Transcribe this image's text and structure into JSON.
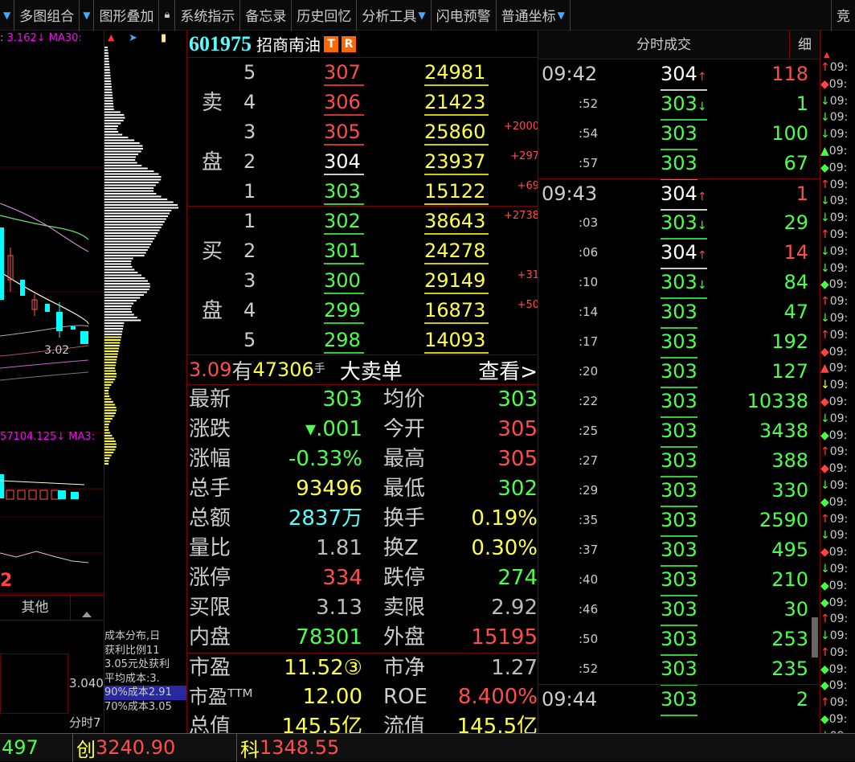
{
  "toolbar": {
    "items": [
      "多图组合",
      "图形叠加",
      "系统指示",
      "备忘录",
      "历史回忆",
      "分析工具",
      "闪电预警",
      "普通坐标"
    ],
    "right_label": "竞"
  },
  "left_panel": {
    "ma_line": "3.162↓ MA30:",
    "price_label": "3.02",
    "vol_line": "57104.125↓ MA3:",
    "red_number": "2",
    "other_tab": "其他",
    "mini_value": "3.040",
    "mini_label": "分时7"
  },
  "chip": {
    "text_lines": [
      "成本分布,日",
      "获利比例11",
      "3.05元处获利",
      "平均成本:3.",
      "90%成本2.91",
      "70%成本3.05"
    ]
  },
  "quote": {
    "code": "601975",
    "name": "招商南油",
    "badge_t": "T",
    "badge_r": "R",
    "sell_label_1": "卖",
    "sell_label_2": "盘",
    "buy_label_1": "买",
    "buy_label_2": "盘",
    "sell": [
      {
        "level": "5",
        "price": "307",
        "volume": "24981",
        "change": ""
      },
      {
        "level": "4",
        "price": "306",
        "volume": "21423",
        "change": ""
      },
      {
        "level": "3",
        "price": "305",
        "volume": "25860",
        "change": "+2000"
      },
      {
        "level": "2",
        "price": "304",
        "volume": "23937",
        "change": "+297"
      },
      {
        "level": "1",
        "price": "303",
        "volume": "15122",
        "change": "+69"
      }
    ],
    "buy": [
      {
        "level": "1",
        "price": "302",
        "volume": "38643",
        "change": "+2738"
      },
      {
        "level": "2",
        "price": "301",
        "volume": "24278",
        "change": ""
      },
      {
        "level": "3",
        "price": "300",
        "volume": "29149",
        "change": "+31"
      },
      {
        "level": "4",
        "price": "299",
        "volume": "16873",
        "change": "+50"
      },
      {
        "level": "5",
        "price": "298",
        "volume": "14093",
        "change": ""
      }
    ],
    "big_order": {
      "price": "3.09",
      "text": "有",
      "amount": "47306",
      "unit": "手",
      "label": "大卖单",
      "link": "查看>"
    },
    "stats": [
      {
        "l1": "最新",
        "v1": "303",
        "c1": "grn",
        "l2": "均价",
        "v2": "303",
        "c2": "grn"
      },
      {
        "l1": "涨跌",
        "v1": "▾.001",
        "c1": "grn",
        "l2": "今开",
        "v2": "305",
        "c2": "red"
      },
      {
        "l1": "涨幅",
        "v1": "-0.33%",
        "c1": "grn",
        "l2": "最高",
        "v2": "305",
        "c2": "red"
      },
      {
        "l1": "总手",
        "v1": "93496",
        "c1": "yel",
        "l2": "最低",
        "v2": "302",
        "c2": "grn"
      },
      {
        "l1": "总额",
        "v1": "2837万",
        "c1": "cyan",
        "l2": "换手",
        "v2": "0.19%",
        "c2": "yel"
      },
      {
        "l1": "量比",
        "v1": "1.81",
        "c1": "gry",
        "l2": "换Z",
        "v2": "0.30%",
        "c2": "yel"
      },
      {
        "l1": "涨停",
        "v1": "334",
        "c1": "red",
        "l2": "跌停",
        "v2": "274",
        "c2": "grn"
      },
      {
        "l1": "买限",
        "v1": "3.13",
        "c1": "gry",
        "l2": "卖限",
        "v2": "2.92",
        "c2": "gry"
      },
      {
        "l1": "内盘",
        "v1": "78301",
        "c1": "grn",
        "l2": "外盘",
        "v2": "15195",
        "c2": "red"
      },
      {
        "l1": "市盈",
        "v1": "11.52③",
        "c1": "yel",
        "l2": "市净",
        "v2": "1.27",
        "c2": "gry"
      },
      {
        "l1": "市盈ᵀᵀᴹ",
        "v1": "12.00",
        "c1": "yel",
        "l2": "ROE",
        "v2": "8.400%",
        "c2": "red"
      },
      {
        "l1": "总值",
        "v1": "145.5亿",
        "c1": "yel",
        "l2": "流值",
        "v2": "145.5亿",
        "c2": "yel"
      }
    ]
  },
  "trades": {
    "title": "分时成交",
    "detail_tab": "细",
    "rows": [
      {
        "time": "09:42",
        "big": true,
        "price": "304",
        "pc": "wht",
        "arrow": "↑",
        "vol": "118",
        "vc": "red"
      },
      {
        "time": ":52",
        "big": false,
        "price": "303",
        "pc": "grn",
        "arrow": "↓",
        "vol": "1",
        "vc": "grn"
      },
      {
        "time": ":54",
        "big": false,
        "price": "303",
        "pc": "grn",
        "arrow": "",
        "vol": "100",
        "vc": "grn"
      },
      {
        "time": ":57",
        "big": false,
        "price": "303",
        "pc": "grn",
        "arrow": "",
        "vol": "67",
        "vc": "grn"
      },
      {
        "time": "09:43",
        "big": true,
        "price": "304",
        "pc": "wht",
        "arrow": "↑",
        "vol": "1",
        "vc": "red"
      },
      {
        "time": ":03",
        "big": false,
        "price": "303",
        "pc": "grn",
        "arrow": "↓",
        "vol": "29",
        "vc": "grn"
      },
      {
        "time": ":06",
        "big": false,
        "price": "304",
        "pc": "wht",
        "arrow": "↑",
        "vol": "14",
        "vc": "red"
      },
      {
        "time": ":10",
        "big": false,
        "price": "303",
        "pc": "grn",
        "arrow": "↓",
        "vol": "84",
        "vc": "grn"
      },
      {
        "time": ":14",
        "big": false,
        "price": "303",
        "pc": "grn",
        "arrow": "",
        "vol": "47",
        "vc": "grn"
      },
      {
        "time": ":17",
        "big": false,
        "price": "303",
        "pc": "grn",
        "arrow": "",
        "vol": "192",
        "vc": "grn"
      },
      {
        "time": ":20",
        "big": false,
        "price": "303",
        "pc": "grn",
        "arrow": "",
        "vol": "127",
        "vc": "grn"
      },
      {
        "time": ":22",
        "big": false,
        "price": "303",
        "pc": "grn",
        "arrow": "",
        "vol": "10338",
        "vc": "grn"
      },
      {
        "time": ":25",
        "big": false,
        "price": "303",
        "pc": "grn",
        "arrow": "",
        "vol": "3438",
        "vc": "grn"
      },
      {
        "time": ":27",
        "big": false,
        "price": "303",
        "pc": "grn",
        "arrow": "",
        "vol": "388",
        "vc": "grn"
      },
      {
        "time": ":29",
        "big": false,
        "price": "303",
        "pc": "grn",
        "arrow": "",
        "vol": "330",
        "vc": "grn"
      },
      {
        "time": ":35",
        "big": false,
        "price": "303",
        "pc": "grn",
        "arrow": "",
        "vol": "2590",
        "vc": "grn"
      },
      {
        "time": ":37",
        "big": false,
        "price": "303",
        "pc": "grn",
        "arrow": "",
        "vol": "495",
        "vc": "grn"
      },
      {
        "time": ":40",
        "big": false,
        "price": "303",
        "pc": "grn",
        "arrow": "",
        "vol": "210",
        "vc": "grn"
      },
      {
        "time": ":46",
        "big": false,
        "price": "303",
        "pc": "grn",
        "arrow": "",
        "vol": "30",
        "vc": "grn"
      },
      {
        "time": ":50",
        "big": false,
        "price": "303",
        "pc": "grn",
        "arrow": "",
        "vol": "253",
        "vc": "grn"
      },
      {
        "time": ":52",
        "big": false,
        "price": "303",
        "pc": "grn",
        "arrow": "",
        "vol": "235",
        "vc": "grn"
      },
      {
        "time": "09:44",
        "big": true,
        "price": "303",
        "pc": "grn",
        "arrow": "",
        "vol": "2",
        "vc": "grn"
      }
    ]
  },
  "right_strip": {
    "rows": [
      {
        "sym": "↑",
        "c": "red",
        "t": "09:"
      },
      {
        "sym": "◆",
        "c": "red",
        "t": "09:"
      },
      {
        "sym": "↓",
        "c": "grn",
        "t": "09:"
      },
      {
        "sym": "↓",
        "c": "grn",
        "t": "09:"
      },
      {
        "sym": "↓",
        "c": "grn",
        "t": "09:"
      },
      {
        "sym": "▲",
        "c": "grn",
        "t": "09:"
      },
      {
        "sym": "◆",
        "c": "grn",
        "t": "09:"
      },
      {
        "sym": "↑",
        "c": "red",
        "t": "09:"
      },
      {
        "sym": "↓",
        "c": "grn",
        "t": "09:"
      },
      {
        "sym": "↓",
        "c": "grn",
        "t": "09:"
      },
      {
        "sym": "↑",
        "c": "red",
        "t": "09:"
      },
      {
        "sym": "↓",
        "c": "grn",
        "t": "09:"
      },
      {
        "sym": "↓",
        "c": "grn",
        "t": "09:"
      },
      {
        "sym": "◆",
        "c": "grn",
        "t": "09:"
      },
      {
        "sym": "↑",
        "c": "red",
        "t": "09:"
      },
      {
        "sym": "↓",
        "c": "grn",
        "t": "09:"
      },
      {
        "sym": "↑",
        "c": "red",
        "t": "09:"
      },
      {
        "sym": "◆",
        "c": "red",
        "t": "09:"
      },
      {
        "sym": "▲",
        "c": "red",
        "t": "09:"
      },
      {
        "sym": "↓",
        "c": "yel",
        "t": "09:"
      },
      {
        "sym": "◆",
        "c": "red",
        "t": "09:"
      },
      {
        "sym": "↓",
        "c": "grn",
        "t": "09:"
      },
      {
        "sym": "◆",
        "c": "grn",
        "t": "09:"
      },
      {
        "sym": "↑",
        "c": "red",
        "t": "09:"
      },
      {
        "sym": "◆",
        "c": "red",
        "t": "09:"
      },
      {
        "sym": "↓",
        "c": "grn",
        "t": "09:"
      },
      {
        "sym": "◆",
        "c": "grn",
        "t": "09:"
      },
      {
        "sym": "↑",
        "c": "red",
        "t": "09:"
      },
      {
        "sym": "↓",
        "c": "grn",
        "t": "09:"
      },
      {
        "sym": "◆",
        "c": "red",
        "t": "09:"
      },
      {
        "sym": "↓",
        "c": "grn",
        "t": "09:"
      },
      {
        "sym": "◆",
        "c": "grn",
        "t": "09:"
      },
      {
        "sym": "◆",
        "c": "grn",
        "t": "09:"
      },
      {
        "sym": "↑",
        "c": "red",
        "t": "09:"
      },
      {
        "sym": "↓",
        "c": "grn",
        "t": "09:"
      },
      {
        "sym": "↑",
        "c": "red",
        "t": "09:"
      },
      {
        "sym": "◆",
        "c": "grn",
        "t": "09:"
      },
      {
        "sym": "◆",
        "c": "grn",
        "t": "09:"
      },
      {
        "sym": "↑",
        "c": "red",
        "t": "09:"
      },
      {
        "sym": "◆",
        "c": "grn",
        "t": "09:"
      },
      {
        "sym": "↓",
        "c": "grn",
        "t": "09:"
      }
    ]
  },
  "status": {
    "first_value": "497",
    "chuang_label": "创",
    "chuang_value": "3240.90",
    "ke_label": "科",
    "ke_value": "1348.55"
  },
  "colors": {
    "up": "#ff4d4d",
    "down": "#4dff4d",
    "volume": "#ffff44",
    "border": "#770000"
  }
}
